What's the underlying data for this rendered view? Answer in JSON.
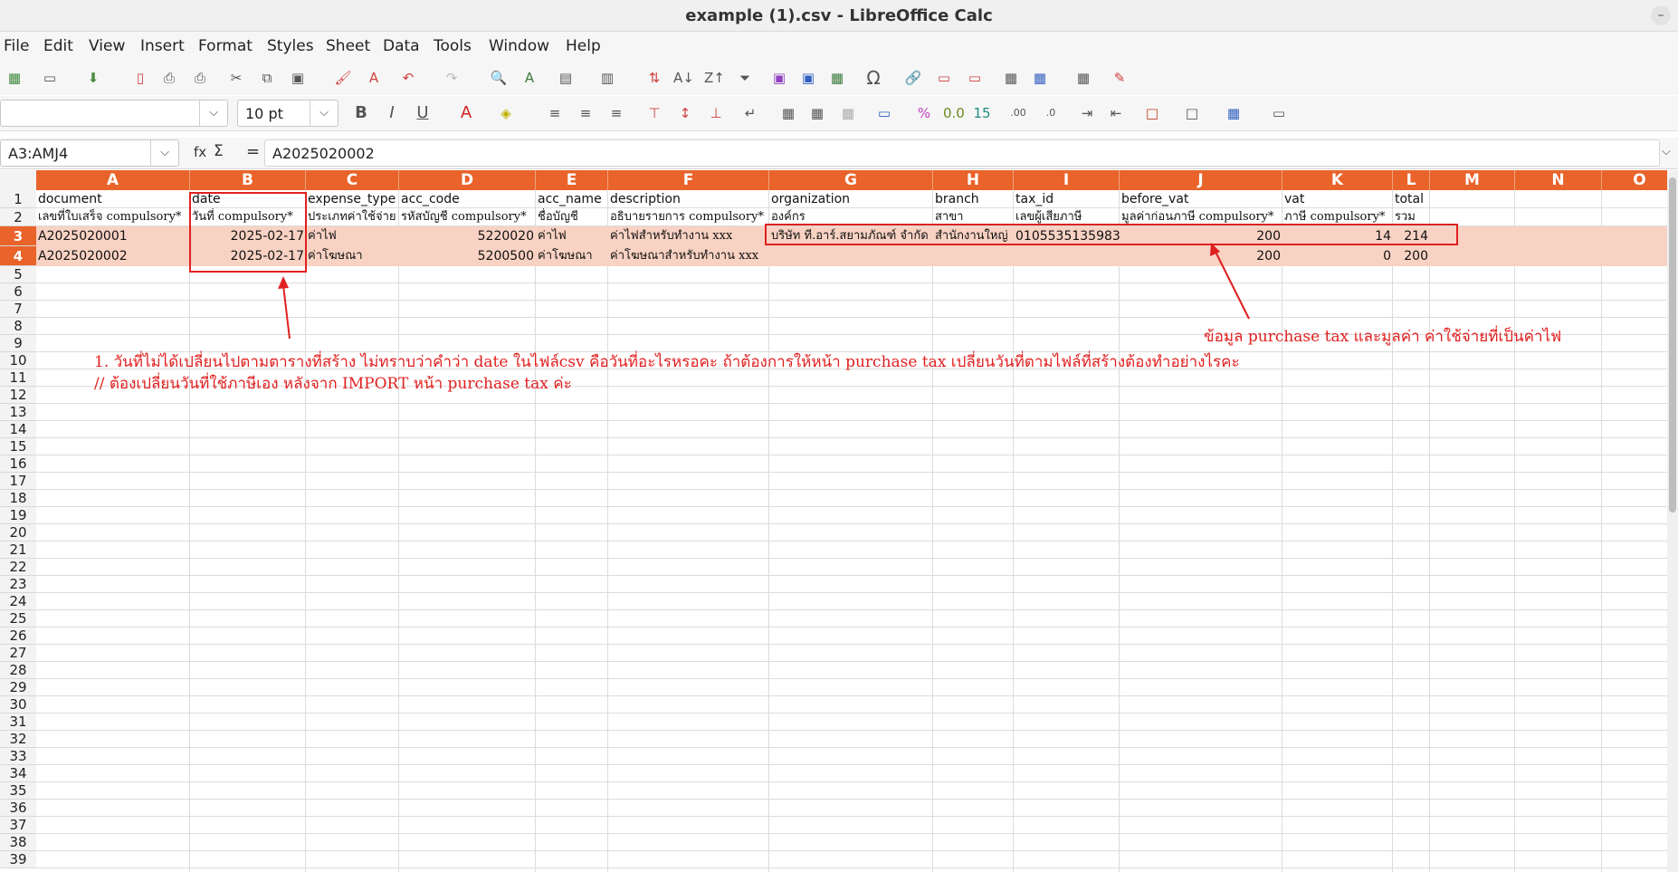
{
  "window": {
    "title": "example (1).csv - LibreOffice Calc"
  },
  "menu": [
    "File",
    "Edit",
    "View",
    "Insert",
    "Format",
    "Styles",
    "Sheet",
    "Data",
    "Tools",
    "Window",
    "Help"
  ],
  "toolbar": {
    "font_name": "",
    "font_size": "10 pt"
  },
  "formula_bar": {
    "cell_ref": "A3:AMJ4",
    "fx_label": "fx",
    "sum_label": "Σ",
    "eq_label": "=",
    "content": "A2025020002"
  },
  "columns": [
    "A",
    "B",
    "C",
    "D",
    "E",
    "F",
    "G",
    "H",
    "I",
    "J",
    "K",
    "L",
    "M",
    "N",
    "O"
  ],
  "row_numbers": [
    "1",
    "2",
    "3",
    "4",
    "5",
    "6",
    "7",
    "8",
    "9",
    "10",
    "11",
    "12",
    "13",
    "14",
    "15",
    "16",
    "17",
    "18",
    "19",
    "20",
    "21",
    "22",
    "23",
    "24",
    "25",
    "26",
    "27",
    "28",
    "29",
    "30",
    "31",
    "32",
    "33",
    "34",
    "35",
    "36",
    "37",
    "38",
    "39"
  ],
  "rows": [
    [
      "document",
      "date",
      "expense_type",
      "acc_code",
      "acc_name",
      "description",
      "organization",
      "branch",
      "tax_id",
      "before_vat",
      "vat",
      "total"
    ],
    [
      "เลขที่ใบเสร็จ compulsory*",
      "วันที่ compulsory*",
      "ประเภทค่าใช้จ่าย",
      "รหัสบัญชี compulsory*",
      "ชื่อบัญชี",
      "อธิบายรายการ compulsory*",
      "องค์กร",
      "สาขา",
      "เลขผู้เสียภาษี",
      "มูลค่าก่อนภาษี compulsory*",
      "ภาษี compulsory*",
      "รวม"
    ],
    [
      "A2025020001",
      "2025-02-17",
      "ค่าไฟ",
      "5220020",
      "ค่าไฟ",
      "ค่าไฟสำหรับทำงาน xxx",
      "บริษัท ที.อาร์.สยามภัณฑ์ จำกัด",
      "สำนักงานใหญ่",
      "0105535135983",
      "200",
      "14",
      "214"
    ],
    [
      "A2025020002",
      "2025-02-17",
      "ค่าโฆษณา",
      "5200500",
      "ค่าโฆษณา",
      "ค่าโฆษณาสำหรับทำงาน xxx",
      "",
      "",
      "",
      "200",
      "0",
      "200"
    ]
  ],
  "annotations": {
    "note1": "1. วันที่ไม่ได้เปลี่ยนไปตามตารางที่สร้าง  ไม่ทราบว่าคำว่า date ในไฟล์csv คือวันที่อะไรหรอคะ ถ้าต้องการให้หน้า purchase tax เปลี่ยนวันที่ตามไฟล์ที่สร้างต้องทำอย่างไรคะ",
    "note2": "// ต้องเปลี่ยนวันที่ใช้ภาษีเอง หลังจาก IMPORT หน้า purchase tax ค่ะ",
    "note3": "ข้อมูล purchase tax และมูลค่า ค่าใช้จ่ายที่เป็นค่าไฟ"
  },
  "colors": {
    "accent": "#e9632a",
    "selection": "#f8d2c3",
    "annotation": "#e02020"
  },
  "icons": {
    "toolbar1": [
      "new-doc",
      "open",
      "save",
      "export-pdf",
      "print",
      "print-preview",
      "cut",
      "copy",
      "paste",
      "clone-format",
      "clear-format",
      "undo",
      "redo",
      "find-replace",
      "spelling",
      "row",
      "column",
      "sort",
      "sort-ascending",
      "sort-descending",
      "autofilter",
      "image",
      "chart",
      "pivot-table",
      "special-character",
      "hyperlink",
      "comment",
      "header-footer",
      "define-print-area",
      "freeze",
      "split-window",
      "show-draw"
    ]
  }
}
